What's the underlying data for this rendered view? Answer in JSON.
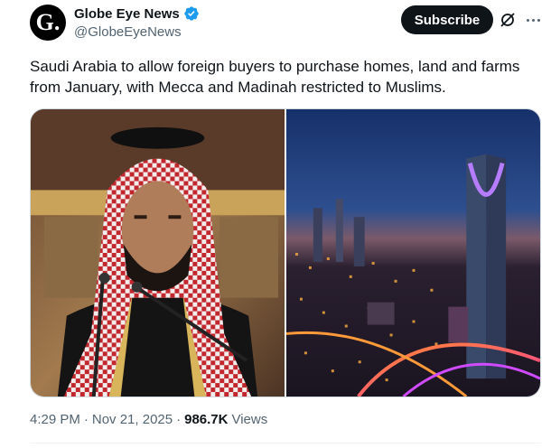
{
  "author": {
    "avatar_letter": "G.",
    "display_name": "Globe Eye News",
    "handle": "@GlobeEyeNews",
    "verified": true,
    "verified_color": "#1d9bf0"
  },
  "actions": {
    "subscribe_label": "Subscribe",
    "grok_icon": "grok-icon",
    "more_icon": "more-icon"
  },
  "tweet": {
    "text": "Saudi Arabia to allow foreign buyers to purchase homes, land and farms from January, with Mecca and Madinah restricted to Muslims."
  },
  "media": [
    {
      "icon": "photo"
    },
    {
      "icon": "photo"
    }
  ],
  "meta": {
    "time": "4:29 PM",
    "separator": "·",
    "date": "Nov 21, 2025",
    "views_count": "986.7K",
    "views_label": "Views"
  }
}
